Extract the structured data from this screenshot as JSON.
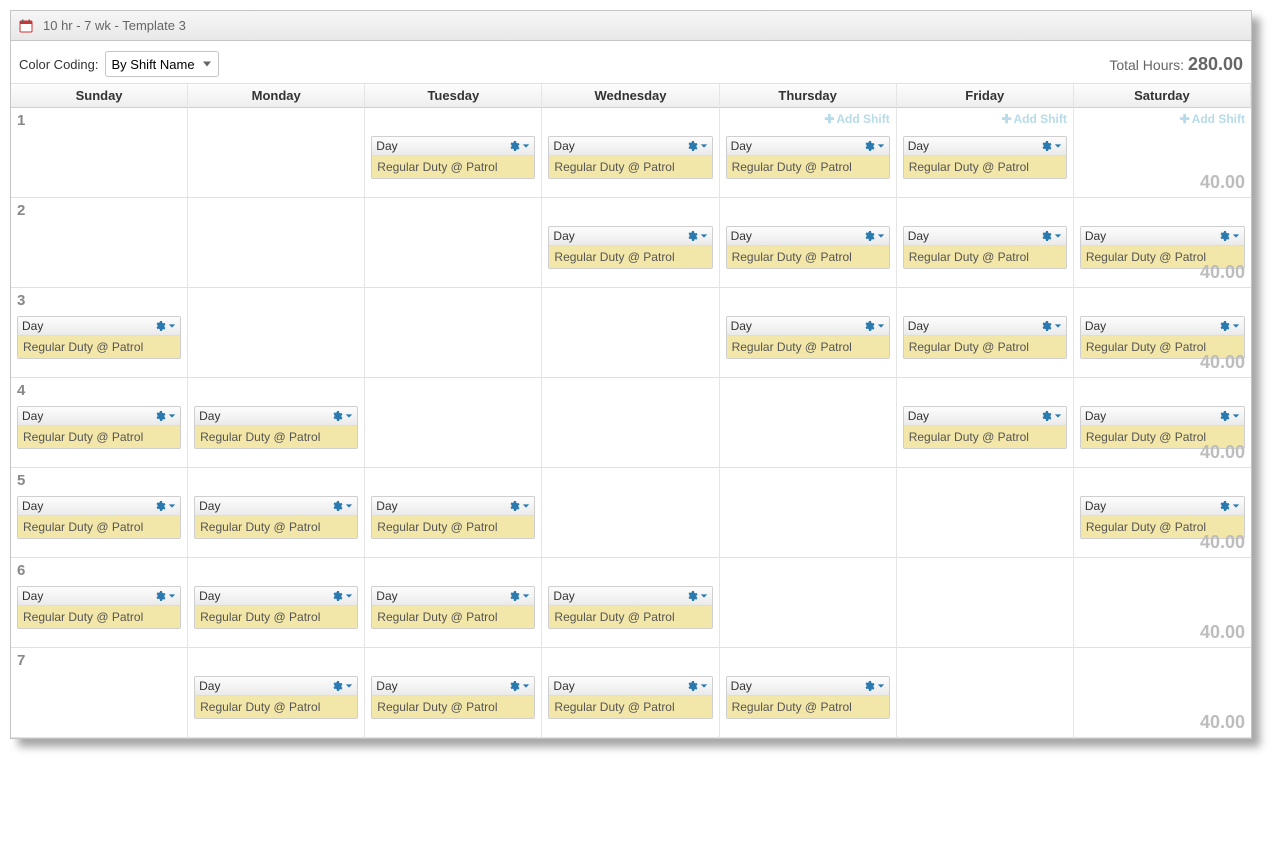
{
  "title": "10 hr - 7 wk - Template 3",
  "colorCoding": {
    "label": "Color Coding:",
    "selected": "By Shift Name"
  },
  "totalHours": {
    "label": "Total Hours:",
    "value": "280.00"
  },
  "addShiftLabel": "Add Shift",
  "days": [
    "Sunday",
    "Monday",
    "Tuesday",
    "Wednesday",
    "Thursday",
    "Friday",
    "Saturday"
  ],
  "shift": {
    "name": "Day",
    "detail": "Regular Duty @ Patrol"
  },
  "weeks": [
    {
      "n": "1",
      "hours": "40.00",
      "cells": [
        false,
        false,
        true,
        true,
        true,
        true,
        false
      ],
      "addHints": [
        false,
        false,
        false,
        false,
        true,
        true,
        true
      ]
    },
    {
      "n": "2",
      "hours": "40.00",
      "cells": [
        false,
        false,
        false,
        true,
        true,
        true,
        true
      ]
    },
    {
      "n": "3",
      "hours": "40.00",
      "cells": [
        true,
        false,
        false,
        false,
        true,
        true,
        true
      ]
    },
    {
      "n": "4",
      "hours": "40.00",
      "cells": [
        true,
        true,
        false,
        false,
        false,
        true,
        true
      ]
    },
    {
      "n": "5",
      "hours": "40.00",
      "cells": [
        true,
        true,
        true,
        false,
        false,
        false,
        true
      ]
    },
    {
      "n": "6",
      "hours": "40.00",
      "cells": [
        true,
        true,
        true,
        true,
        false,
        false,
        false
      ]
    },
    {
      "n": "7",
      "hours": "40.00",
      "cells": [
        false,
        true,
        true,
        true,
        true,
        false,
        false
      ]
    }
  ]
}
